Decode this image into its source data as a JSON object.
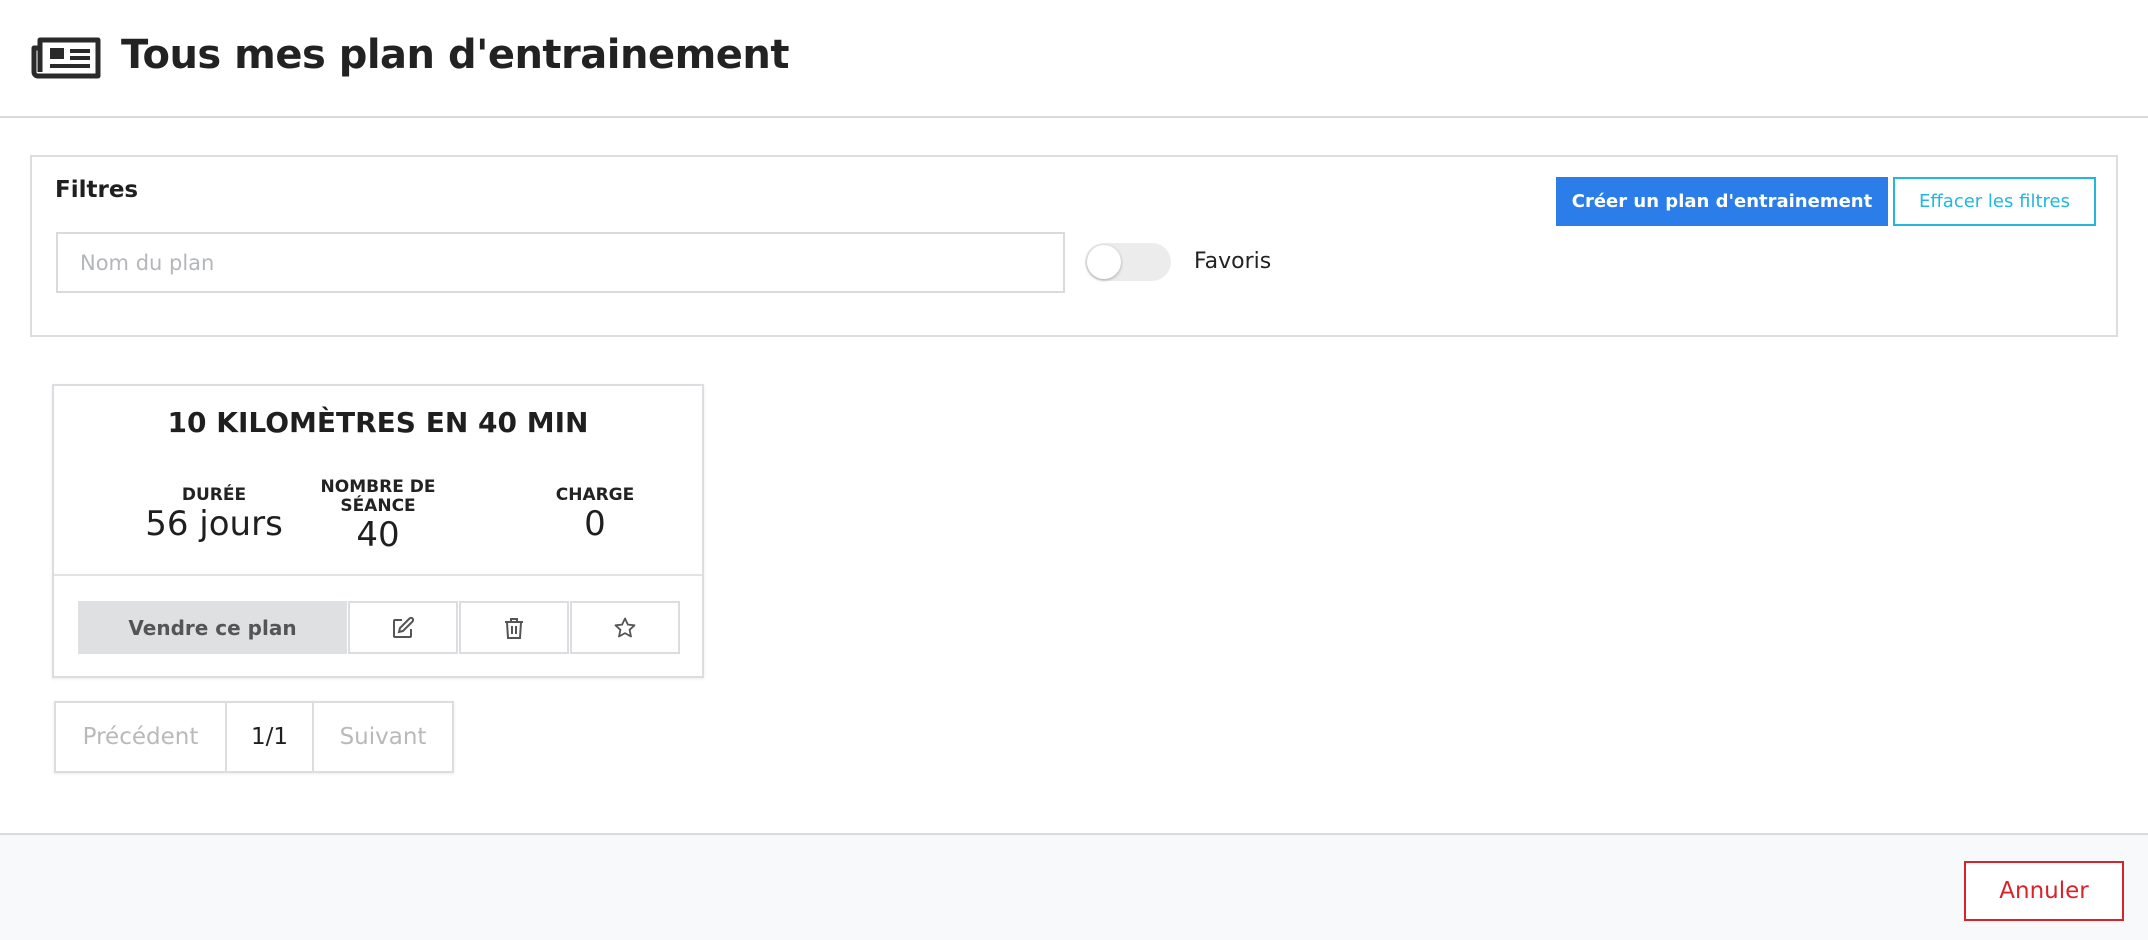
{
  "header": {
    "icon": "newspaper-icon",
    "title": "Tous mes plan d'entrainement"
  },
  "filters": {
    "title": "Filtres",
    "search": {
      "placeholder": "Nom du plan",
      "value": ""
    },
    "favorites": {
      "label": "Favoris",
      "enabled": false
    },
    "create_label": "Créer un plan d'entrainement",
    "clear_label": "Effacer les filtres"
  },
  "plans": [
    {
      "title": "10 KILOMÈTRES EN 40 MIN",
      "stats": [
        {
          "label": "DURÉE",
          "value": "56 jours"
        },
        {
          "label": "NOMBRE DE SÉANCE",
          "value": "40"
        },
        {
          "label": "CHARGE",
          "value": "0"
        }
      ],
      "sell_label": "Vendre ce plan",
      "action_icons": [
        "edit-icon",
        "trash-icon",
        "star-icon"
      ]
    }
  ],
  "pagination": {
    "prev_label": "Précédent",
    "current": "1/1",
    "next_label": "Suivant"
  },
  "footer": {
    "cancel_label": "Annuler"
  },
  "colors": {
    "primary": "#2b7de9",
    "info": "#20b8dc",
    "danger": "#d8232a",
    "footer_bg": "#f8f9fb"
  }
}
